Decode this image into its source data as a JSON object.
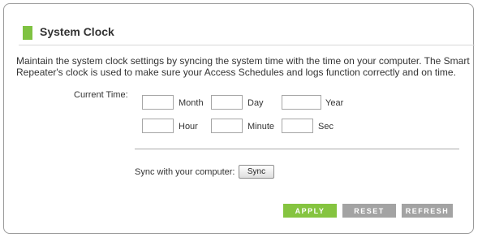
{
  "section": {
    "title": "System Clock",
    "description": "Maintain the system clock settings by syncing the system time with the time on your computer. The Smart Repeater's clock is used to make sure your Access Schedules and logs function correctly and on time."
  },
  "current_time": {
    "label": "Current Time:",
    "fields": {
      "month": {
        "label": "Month",
        "value": ""
      },
      "day": {
        "label": "Day",
        "value": ""
      },
      "year": {
        "label": "Year",
        "value": ""
      },
      "hour": {
        "label": "Hour",
        "value": ""
      },
      "minute": {
        "label": "Minute",
        "value": ""
      },
      "sec": {
        "label": "Sec",
        "value": ""
      }
    }
  },
  "sync": {
    "label": "Sync with your computer:",
    "button_label": "Sync"
  },
  "actions": {
    "apply": "APPLY",
    "reset": "RESET",
    "refresh": "REFRESH"
  },
  "colors": {
    "accent_green": "#7fc242",
    "apply_bg": "#85c440",
    "secondary_bg": "#a3a3a3",
    "border": "#9a9a9a"
  }
}
